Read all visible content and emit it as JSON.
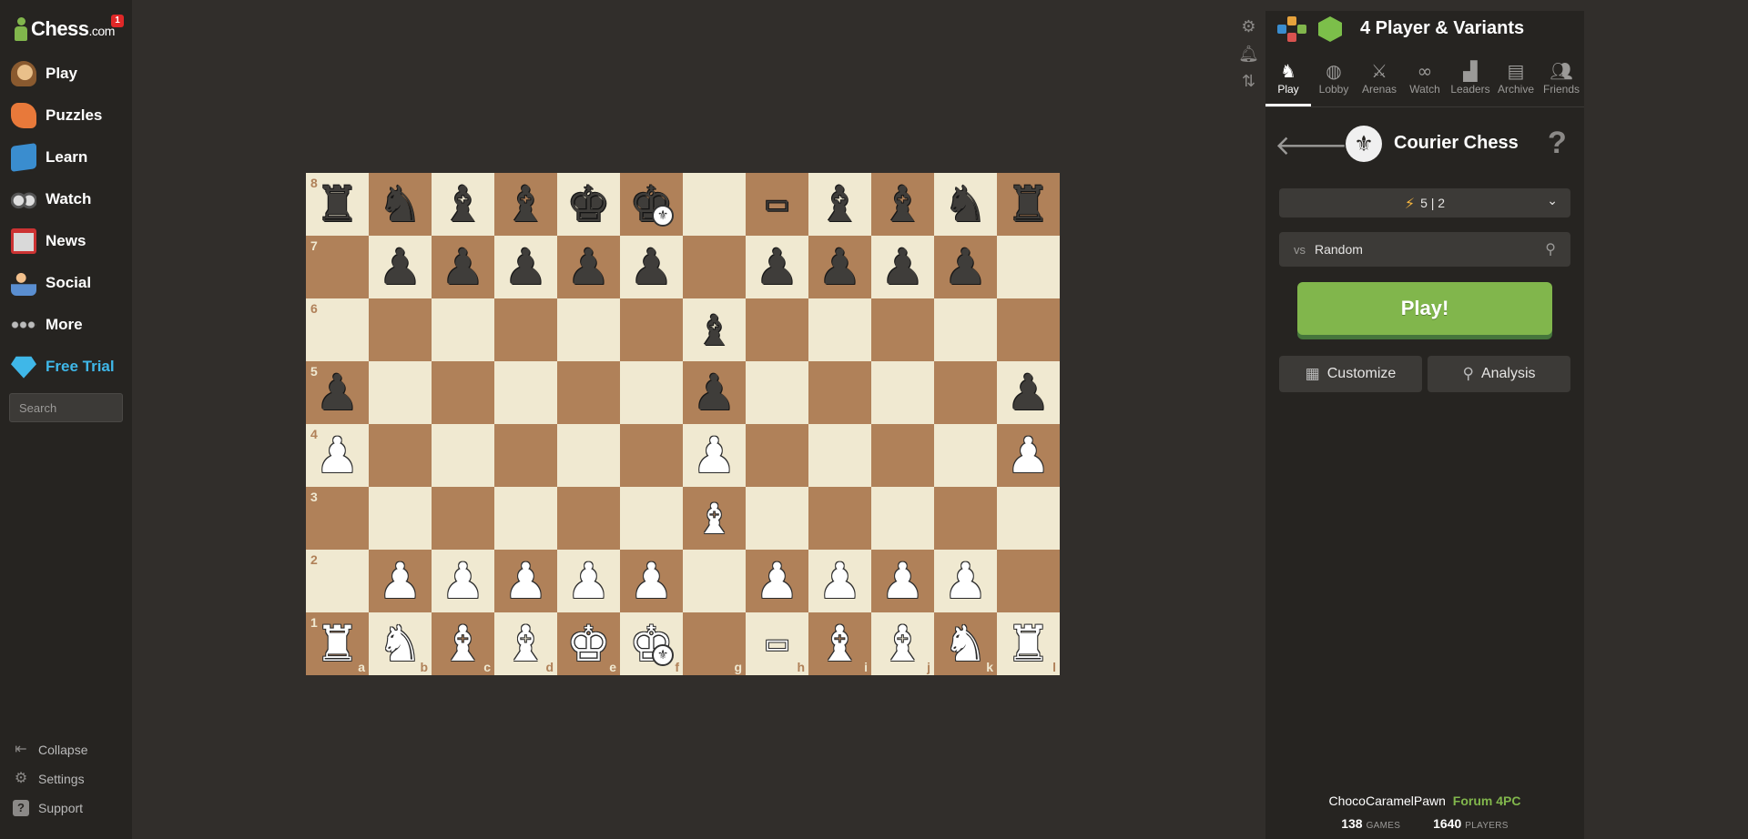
{
  "sidebar": {
    "logo_text": "Chess",
    "logo_suffix": ".com",
    "notification_count": "1",
    "items": [
      {
        "label": "Play",
        "icon": "play-icon"
      },
      {
        "label": "Puzzles",
        "icon": "puzzles-icon"
      },
      {
        "label": "Learn",
        "icon": "learn-icon"
      },
      {
        "label": "Watch",
        "icon": "watch-icon"
      },
      {
        "label": "News",
        "icon": "news-icon"
      },
      {
        "label": "Social",
        "icon": "social-icon"
      },
      {
        "label": "More",
        "icon": "more-icon"
      },
      {
        "label": "Free Trial",
        "icon": "diamond-icon"
      }
    ],
    "search_placeholder": "Search",
    "bottom": [
      {
        "label": "Collapse",
        "icon": "collapse-icon"
      },
      {
        "label": "Settings",
        "icon": "gear-icon"
      },
      {
        "label": "Support",
        "icon": "support-icon"
      }
    ]
  },
  "board": {
    "files": [
      "a",
      "b",
      "c",
      "d",
      "e",
      "f",
      "g",
      "h",
      "i",
      "j",
      "k",
      "l"
    ],
    "ranks": [
      "8",
      "7",
      "6",
      "5",
      "4",
      "3",
      "2",
      "1"
    ],
    "rows": [
      [
        "bR",
        "bN",
        "bB",
        "bB",
        "bK",
        "bK*",
        "",
        "bM",
        "bB",
        "bB",
        "bN",
        "bR"
      ],
      [
        "",
        "bP",
        "bP",
        "bP",
        "bP",
        "bP",
        "",
        "bP",
        "bP",
        "bP",
        "bP",
        ""
      ],
      [
        "",
        "",
        "",
        "",
        "",
        "",
        "bF",
        "",
        "",
        "",
        "",
        ""
      ],
      [
        "bP",
        "",
        "",
        "",
        "",
        "",
        "bP",
        "",
        "",
        "",
        "",
        "bP"
      ],
      [
        "wP",
        "",
        "",
        "",
        "",
        "",
        "wP",
        "",
        "",
        "",
        "",
        "wP"
      ],
      [
        "",
        "",
        "",
        "",
        "",
        "",
        "wF",
        "",
        "",
        "",
        "",
        ""
      ],
      [
        "",
        "wP",
        "wP",
        "wP",
        "wP",
        "wP",
        "",
        "wP",
        "wP",
        "wP",
        "wP",
        ""
      ],
      [
        "wR",
        "wN",
        "wB",
        "wB",
        "wK",
        "wK*",
        "",
        "wM",
        "wB",
        "wB",
        "wN",
        "wR"
      ]
    ],
    "light_color": "#f0e9d1",
    "dark_color": "#b08159"
  },
  "tools": [
    "gear-icon",
    "bell-icon",
    "flip-board-icon"
  ],
  "panel": {
    "title": "4 Player & Variants",
    "tabs": [
      {
        "label": "Play",
        "icon": "play-tab-icon",
        "active": true
      },
      {
        "label": "Lobby",
        "icon": "globe-icon"
      },
      {
        "label": "Arenas",
        "icon": "swords-icon"
      },
      {
        "label": "Watch",
        "icon": "binoculars-icon"
      },
      {
        "label": "Leaders",
        "icon": "podium-icon"
      },
      {
        "label": "Archive",
        "icon": "archive-icon"
      },
      {
        "label": "Friends",
        "icon": "friends-icon"
      }
    ],
    "variant_name": "Courier Chess",
    "help_label": "?",
    "time_control": "5 | 2",
    "opponent_prefix": "vs",
    "opponent": "Random",
    "play_label": "Play!",
    "customize_label": "Customize",
    "analysis_label": "Analysis",
    "footer": {
      "username": "ChocoCaramelPawn",
      "forum_label": "Forum 4PC",
      "games_count": "138",
      "games_label": "GAMES",
      "players_count": "1640",
      "players_label": "PLAYERS"
    }
  },
  "colors": {
    "accent_green": "#81b64c",
    "trial_blue": "#3fb7e8",
    "background": "#312e2b",
    "panel": "#262421"
  }
}
